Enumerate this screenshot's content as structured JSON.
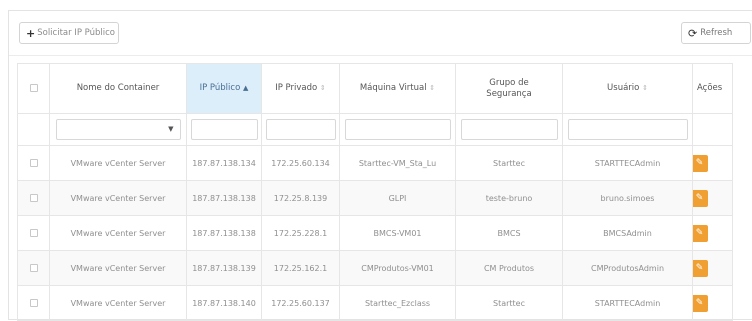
{
  "toolbar": {
    "solicitar_label": "Solicitar IP Público",
    "refresh_label": "Refresh"
  },
  "table": {
    "headers": [
      "Nome do Container",
      "IP Público",
      "IP Privado",
      "Máquina Virtual",
      "Grupo de",
      "Segurança",
      "Usuário",
      "Ações"
    ],
    "rows": [
      [
        "VMware vCenter Server",
        "187.87.138.134",
        "172.25.60.134",
        "Starttec-VM_Sta_Lu",
        "Starttec",
        "STARTTECAdmin"
      ],
      [
        "VMware vCenter Server",
        "187.87.138.138",
        "172.25.8.139",
        "GLPI",
        "teste-bruno",
        "bruno.simoes"
      ],
      [
        "VMware vCenter Server",
        "187.87.138.138",
        "172.25.228.1",
        "BMCS-VM01",
        "BMCS",
        "BMCSAdmin"
      ],
      [
        "VMware vCenter Server",
        "187.87.138.139",
        "172.25.162.1",
        "CMProdutos-VM01",
        "CM Produtos",
        "CMProdutosAdmin"
      ],
      [
        "VMware vCenter Server",
        "187.87.138.140",
        "172.25.60.137",
        "Starttec_Ezclass",
        "Starttec",
        "STARTTECAdmin"
      ]
    ]
  },
  "icons": {
    "add": "plus-icon",
    "refresh": "refresh-icon",
    "action": "wrench-icon"
  },
  "colors": {
    "sorted_header_bg": "#ddeefb",
    "action_button": "#f0a033"
  }
}
